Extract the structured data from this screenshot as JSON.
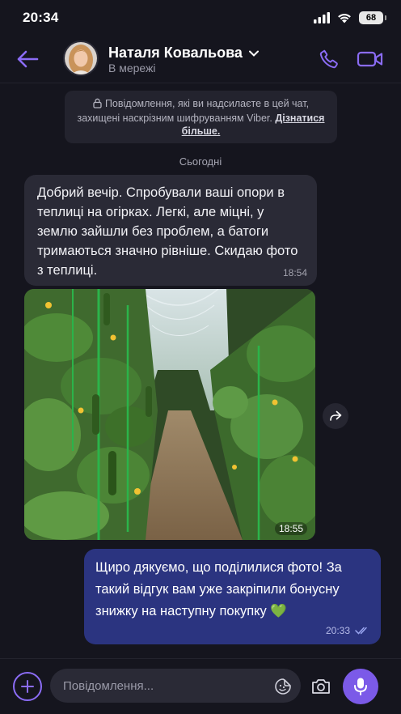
{
  "status_bar": {
    "time": "20:34",
    "battery": "68"
  },
  "header": {
    "contact_name": "Наталя Ковальова",
    "contact_status": "В мережі",
    "accent_color": "#8b6cf5"
  },
  "encryption_notice": {
    "text": "Повідомлення, які ви надсилаєте в цей чат, захищені наскрізним шифруванням Viber.",
    "link": "Дізнатися більше."
  },
  "date_separator": "Сьогодні",
  "messages": [
    {
      "direction": "incoming",
      "type": "text",
      "text": "Добрий вечір. Спробували ваші опори в теплиці на огірках. Легкі, але міцні, у землю зайшли без проблем, а батоги тримаються значно рівніше. Скидаю фото з теплиці.",
      "time": "18:54"
    },
    {
      "direction": "incoming",
      "type": "photo",
      "time": "18:55"
    },
    {
      "direction": "outgoing",
      "type": "text",
      "text": "Щиро дякуємо, що поділилися фото! За такий відгук вам уже закріпили бонусну знижку на наступну покупку 💚",
      "time": "20:33",
      "status": "read"
    }
  ],
  "input": {
    "placeholder": "Повідомлення..."
  }
}
